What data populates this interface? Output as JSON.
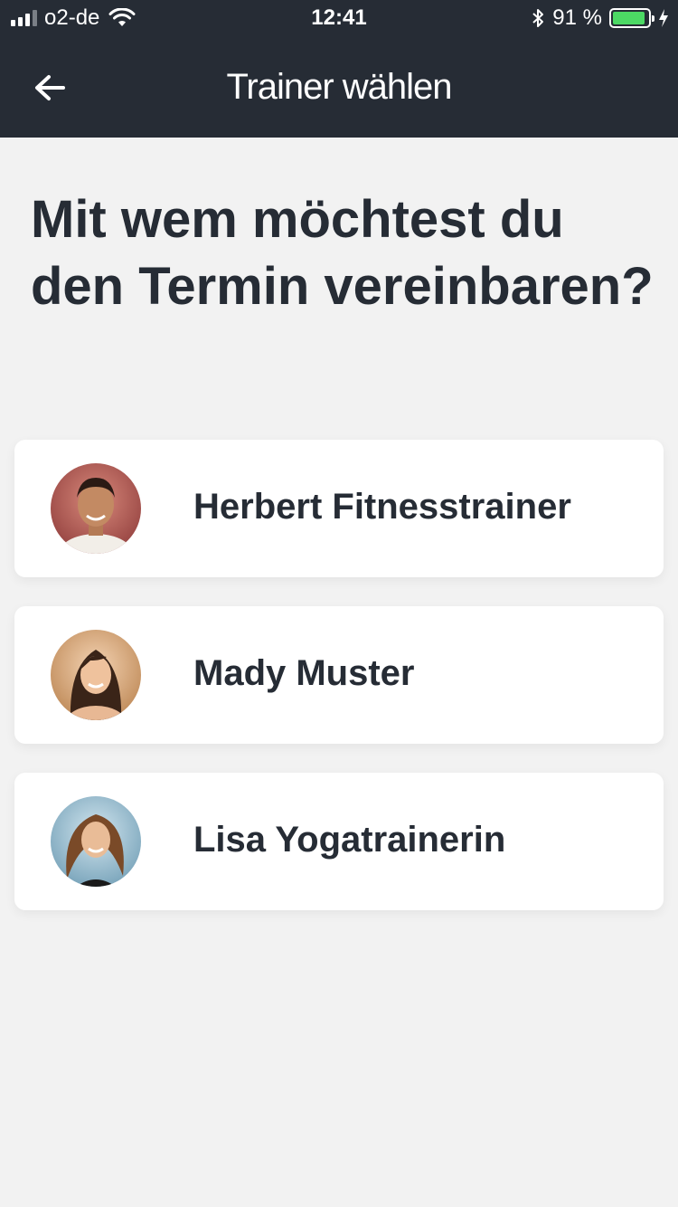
{
  "status_bar": {
    "carrier": "o2-de",
    "time": "12:41",
    "battery_percent": "91 %",
    "battery_level": 0.91,
    "icons": [
      "signal-icon",
      "wifi-icon",
      "bluetooth-icon",
      "battery-icon",
      "charging-icon"
    ]
  },
  "nav": {
    "title": "Trainer wählen",
    "back_icon": "arrow-left-icon"
  },
  "headline": "Mit wem möchtest du den Termin vereinbaren?",
  "trainers": [
    {
      "name": "Herbert Fitnesstrainer"
    },
    {
      "name": "Mady Muster"
    },
    {
      "name": "Lisa Yogatrainerin"
    }
  ],
  "colors": {
    "header_bg": "#262c35",
    "page_bg": "#f2f2f2",
    "card_bg": "#ffffff",
    "text": "#262c35",
    "battery_green": "#4cd964"
  }
}
